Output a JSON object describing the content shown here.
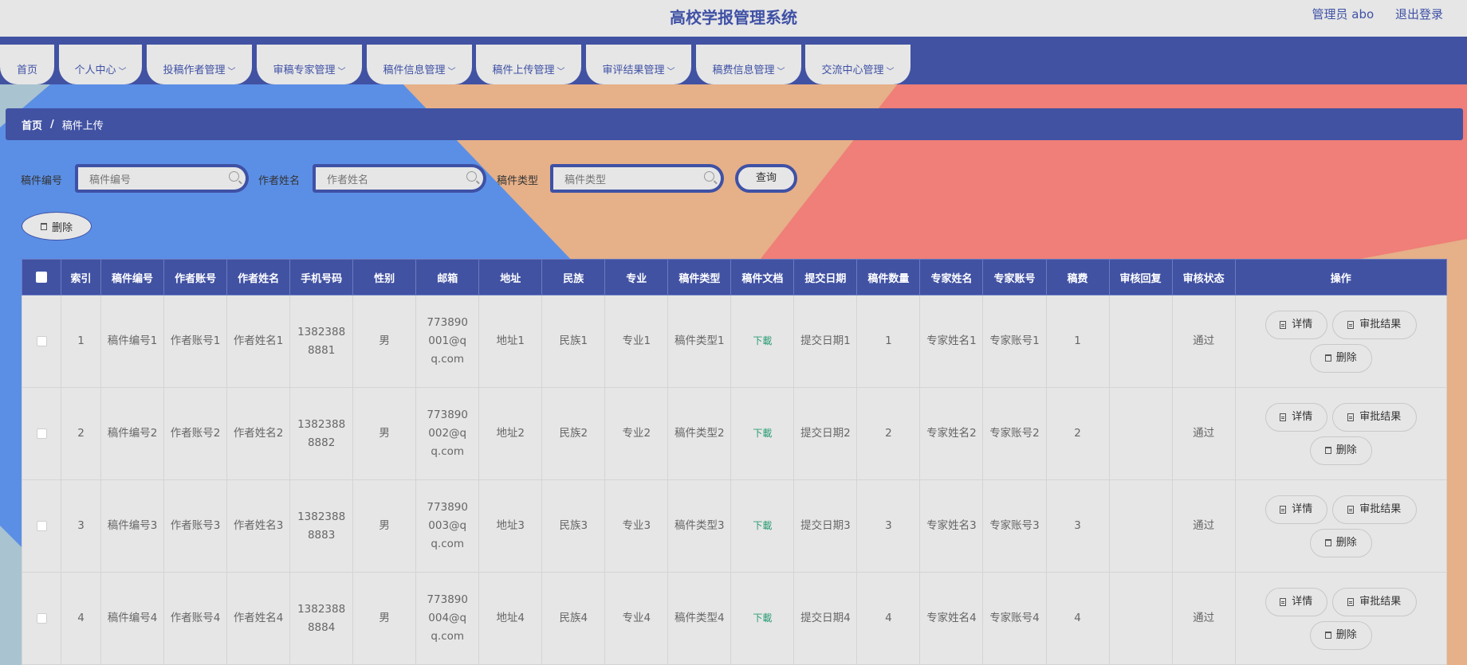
{
  "header": {
    "app_title": "高校学报管理系统",
    "admin_label": "管理员 abo",
    "logout_label": "退出登录"
  },
  "nav": {
    "tabs": [
      {
        "label": "首页",
        "has_dropdown": false
      },
      {
        "label": "个人中心",
        "has_dropdown": true
      },
      {
        "label": "投稿作者管理",
        "has_dropdown": true
      },
      {
        "label": "审稿专家管理",
        "has_dropdown": true
      },
      {
        "label": "稿件信息管理",
        "has_dropdown": true
      },
      {
        "label": "稿件上传管理",
        "has_dropdown": true
      },
      {
        "label": "审评结果管理",
        "has_dropdown": true
      },
      {
        "label": "稿费信息管理",
        "has_dropdown": true
      },
      {
        "label": "交流中心管理",
        "has_dropdown": true
      }
    ]
  },
  "breadcrumb": {
    "home": "首页",
    "separator": "/",
    "current": "稿件上传"
  },
  "search": {
    "fields": [
      {
        "label": "稿件编号",
        "placeholder": "稿件编号"
      },
      {
        "label": "作者姓名",
        "placeholder": "作者姓名"
      },
      {
        "label": "稿件类型",
        "placeholder": "稿件类型"
      }
    ],
    "query_label": "查询"
  },
  "toolbar": {
    "delete_label": "删除"
  },
  "table": {
    "headers": [
      "",
      "索引",
      "稿件编号",
      "作者账号",
      "作者姓名",
      "手机号码",
      "性别",
      "邮箱",
      "地址",
      "民族",
      "专业",
      "稿件类型",
      "稿件文档",
      "提交日期",
      "稿件数量",
      "专家姓名",
      "专家账号",
      "稿费",
      "审核回复",
      "审核状态",
      "操作"
    ],
    "download_label": "下載",
    "actions": {
      "detail": "详情",
      "review": "审批结果",
      "delete": "删除"
    },
    "rows": [
      {
        "index": "1",
        "code": "稿件编号1",
        "account": "作者账号1",
        "author": "作者姓名1",
        "phone": "13823888881",
        "gender": "男",
        "email": "773890001@qq.com",
        "address": "地址1",
        "ethnicity": "民族1",
        "major": "专业1",
        "type": "稿件类型1",
        "date": "提交日期1",
        "count": "1",
        "expert_name": "专家姓名1",
        "expert_account": "专家账号1",
        "fee": "1",
        "reply": "",
        "status": "通过"
      },
      {
        "index": "2",
        "code": "稿件编号2",
        "account": "作者账号2",
        "author": "作者姓名2",
        "phone": "13823888882",
        "gender": "男",
        "email": "773890002@qq.com",
        "address": "地址2",
        "ethnicity": "民族2",
        "major": "专业2",
        "type": "稿件类型2",
        "date": "提交日期2",
        "count": "2",
        "expert_name": "专家姓名2",
        "expert_account": "专家账号2",
        "fee": "2",
        "reply": "",
        "status": "通过"
      },
      {
        "index": "3",
        "code": "稿件编号3",
        "account": "作者账号3",
        "author": "作者姓名3",
        "phone": "13823888883",
        "gender": "男",
        "email": "773890003@qq.com",
        "address": "地址3",
        "ethnicity": "民族3",
        "major": "专业3",
        "type": "稿件类型3",
        "date": "提交日期3",
        "count": "3",
        "expert_name": "专家姓名3",
        "expert_account": "专家账号3",
        "fee": "3",
        "reply": "",
        "status": "通过"
      },
      {
        "index": "4",
        "code": "稿件编号4",
        "account": "作者账号4",
        "author": "作者姓名4",
        "phone": "13823888884",
        "gender": "男",
        "email": "773890004@qq.com",
        "address": "地址4",
        "ethnicity": "民族4",
        "major": "专业4",
        "type": "稿件类型4",
        "date": "提交日期4",
        "count": "4",
        "expert_name": "专家姓名4",
        "expert_account": "专家账号4",
        "fee": "4",
        "reply": "",
        "status": "通过"
      }
    ]
  },
  "colors": {
    "primary": "#4152a3",
    "panel": "#e6e6e6",
    "bg_blue": "#5b8fe6",
    "bg_orange": "#e6b088",
    "bg_red": "#ef7f78",
    "bg_teal": "#a9c3d0",
    "download_green": "#2a9d73"
  }
}
